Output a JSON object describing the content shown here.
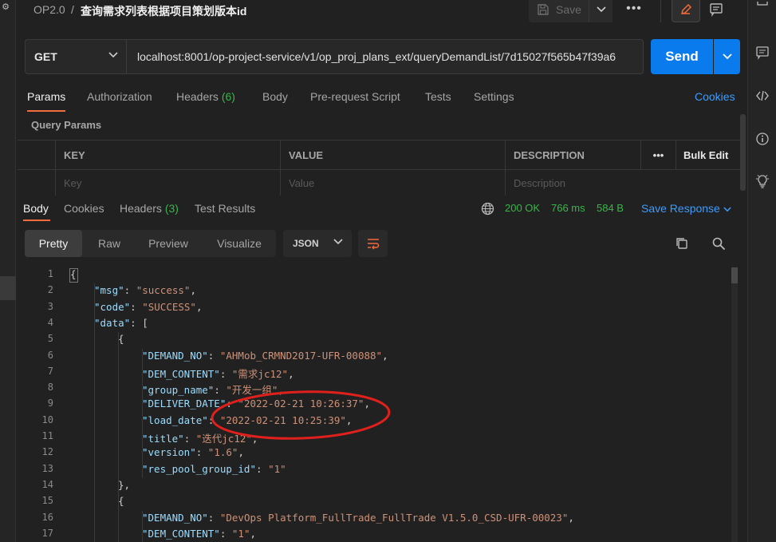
{
  "header": {
    "workspace": "OP2.0",
    "separator": "/",
    "request_name": "查询需求列表根据项目策划版本id",
    "save_label": "Save",
    "more_label": "•••"
  },
  "request": {
    "method": "GET",
    "url": "localhost:8001/op-project-service/v1/op_proj_plans_ext/queryDemandList/7d15027f565b47f39a6",
    "send_label": "Send"
  },
  "request_tabs": [
    {
      "label": "Params",
      "count": ""
    },
    {
      "label": "Authorization",
      "count": ""
    },
    {
      "label": "Headers",
      "count": "(6)"
    },
    {
      "label": "Body",
      "count": ""
    },
    {
      "label": "Pre-request Script",
      "count": ""
    },
    {
      "label": "Tests",
      "count": ""
    },
    {
      "label": "Settings",
      "count": ""
    }
  ],
  "cookies_link": "Cookies",
  "query_params": {
    "title": "Query Params",
    "columns": [
      "KEY",
      "VALUE",
      "DESCRIPTION"
    ],
    "more_label": "•••",
    "bulk_edit": "Bulk Edit",
    "placeholders": [
      "Key",
      "Value",
      "Description"
    ]
  },
  "response_tabs": [
    {
      "label": "Body",
      "count": ""
    },
    {
      "label": "Cookies",
      "count": ""
    },
    {
      "label": "Headers",
      "count": "(3)"
    },
    {
      "label": "Test Results",
      "count": ""
    }
  ],
  "response_status": {
    "status": "200 OK",
    "time": "766 ms",
    "size": "584 B",
    "save_response": "Save Response"
  },
  "view_modes": [
    "Pretty",
    "Raw",
    "Preview",
    "Visualize"
  ],
  "format": "JSON",
  "colors": {
    "accent": "#f26b3a",
    "send": "#097bed",
    "link": "#3b9cff",
    "success": "#39b54a",
    "json_key": "#9cdcfe",
    "json_string": "#ce9178",
    "annotation": "#e0201c"
  },
  "icons": {
    "save": "save-icon",
    "edit": "pencil-icon",
    "docs": "comment-icon",
    "globe": "globe-icon",
    "copy": "copy-icon",
    "search": "search-icon",
    "wrap": "wrap-lines-icon"
  },
  "code_lines": [
    {
      "n": "1",
      "indent": 0,
      "parts": [
        [
          "p",
          "{"
        ]
      ]
    },
    {
      "n": "2",
      "indent": 1,
      "parts": [
        [
          "k",
          "\"msg\""
        ],
        [
          "p",
          ": "
        ],
        [
          "s",
          "\"success\""
        ],
        [
          "p",
          ","
        ]
      ]
    },
    {
      "n": "3",
      "indent": 1,
      "parts": [
        [
          "k",
          "\"code\""
        ],
        [
          "p",
          ": "
        ],
        [
          "s",
          "\"SUCCESS\""
        ],
        [
          "p",
          ","
        ]
      ]
    },
    {
      "n": "4",
      "indent": 1,
      "parts": [
        [
          "k",
          "\"data\""
        ],
        [
          "p",
          ": ["
        ]
      ]
    },
    {
      "n": "5",
      "indent": 2,
      "parts": [
        [
          "p",
          "{"
        ]
      ]
    },
    {
      "n": "6",
      "indent": 3,
      "parts": [
        [
          "k",
          "\"DEMAND_NO\""
        ],
        [
          "p",
          ": "
        ],
        [
          "s",
          "\"AHMob_CRMND2017-UFR-00088\""
        ],
        [
          "p",
          ","
        ]
      ]
    },
    {
      "n": "7",
      "indent": 3,
      "parts": [
        [
          "k",
          "\"DEM_CONTENT\""
        ],
        [
          "p",
          ": "
        ],
        [
          "s",
          "\"需求jc12\""
        ],
        [
          "p",
          ","
        ]
      ]
    },
    {
      "n": "8",
      "indent": 3,
      "parts": [
        [
          "k",
          "\"group_name\""
        ],
        [
          "p",
          ": "
        ],
        [
          "s",
          "\"开发一组\""
        ],
        [
          "p",
          ","
        ]
      ]
    },
    {
      "n": "9",
      "indent": 3,
      "parts": [
        [
          "k",
          "\"DELIVER_DATE\""
        ],
        [
          "p",
          ": "
        ],
        [
          "s",
          "\"2022-02-21 10:26:37\""
        ],
        [
          "p",
          ","
        ]
      ]
    },
    {
      "n": "10",
      "indent": 3,
      "parts": [
        [
          "k",
          "\"load_date\""
        ],
        [
          "p",
          ": "
        ],
        [
          "s",
          "\"2022-02-21 10:25:39\""
        ],
        [
          "p",
          ","
        ]
      ]
    },
    {
      "n": "11",
      "indent": 3,
      "parts": [
        [
          "k",
          "\"title\""
        ],
        [
          "p",
          ": "
        ],
        [
          "s",
          "\"迭代jc12\""
        ],
        [
          "p",
          ","
        ]
      ]
    },
    {
      "n": "12",
      "indent": 3,
      "parts": [
        [
          "k",
          "\"version\""
        ],
        [
          "p",
          ": "
        ],
        [
          "s",
          "\"1.6\""
        ],
        [
          "p",
          ","
        ]
      ]
    },
    {
      "n": "13",
      "indent": 3,
      "parts": [
        [
          "k",
          "\"res_pool_group_id\""
        ],
        [
          "p",
          ": "
        ],
        [
          "s",
          "\"1\""
        ]
      ]
    },
    {
      "n": "14",
      "indent": 2,
      "parts": [
        [
          "p",
          "},"
        ]
      ]
    },
    {
      "n": "15",
      "indent": 2,
      "parts": [
        [
          "p",
          "{"
        ]
      ]
    },
    {
      "n": "16",
      "indent": 3,
      "parts": [
        [
          "k",
          "\"DEMAND_NO\""
        ],
        [
          "p",
          ": "
        ],
        [
          "s",
          "\"DevOps Platform_FullTrade_FullTrade V1.5.0_CSD-UFR-00023\""
        ],
        [
          "p",
          ","
        ]
      ]
    },
    {
      "n": "17",
      "indent": 3,
      "parts": [
        [
          "k",
          "\"DEM_CONTENT\""
        ],
        [
          "p",
          ": "
        ],
        [
          "s",
          "\"1\""
        ],
        [
          "p",
          ","
        ]
      ]
    }
  ]
}
